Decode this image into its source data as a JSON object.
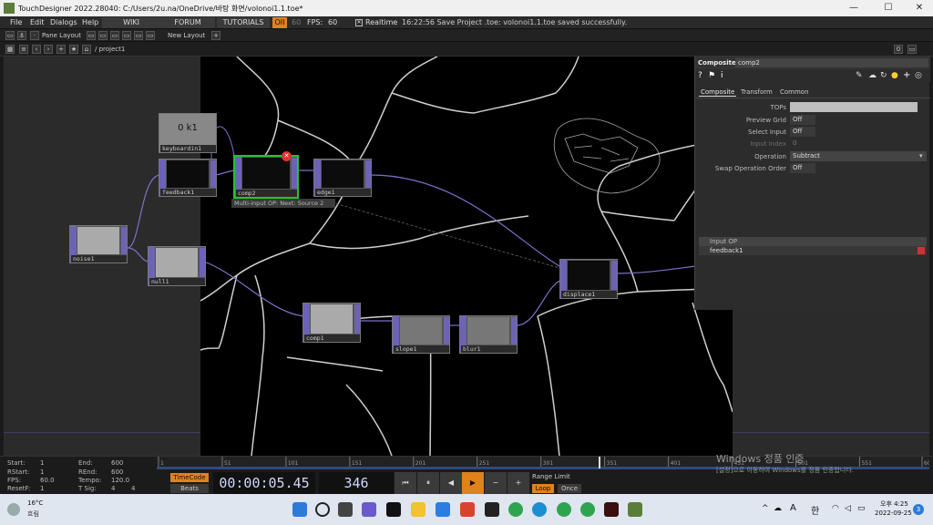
{
  "window": {
    "title": "TouchDesigner 2022.28040: C:/Users/2u.na/OneDrive/바탕 화면/volonoi1.1.toe*"
  },
  "menu": {
    "file": "File",
    "edit": "Edit",
    "dialogs": "Dialogs",
    "help": "Help",
    "wiki": "WIKI",
    "forum": "FORUM",
    "tutorials": "TUTORIALS",
    "oii": "OII",
    "fps_label": "FPS:",
    "fps_value": "60",
    "fps_dim": "60",
    "realtime": "Realtime",
    "status": "16:22:56 Save Project .toe: volonoi1.1.toe saved successfully."
  },
  "panebar": {
    "pane_layout": "Pane Layout",
    "new_layout": "New Layout"
  },
  "path": {
    "current": "/ project1"
  },
  "nodes": {
    "keyboardin": {
      "label": "keyboardin1",
      "value": "0 k1"
    },
    "feedback": {
      "label": "feedback1"
    },
    "comp2": {
      "label": "comp2"
    },
    "edge": {
      "label": "edge1"
    },
    "noise": {
      "label": "noise1"
    },
    "null": {
      "label": "null1"
    },
    "comp1": {
      "label": "comp1"
    },
    "slope": {
      "label": "slope1"
    },
    "blur": {
      "label": "blur1"
    },
    "displace": {
      "label": "displace1"
    },
    "tooltip": "Multi-input OP: Next: Source 2"
  },
  "panel": {
    "header_type": "Composite",
    "header_name": "comp2",
    "tabs": [
      "Composite",
      "Transform",
      "Common"
    ],
    "params": [
      {
        "label": "TOPs",
        "value": ""
      },
      {
        "label": "Preview Grid",
        "value": "Off"
      },
      {
        "label": "Select Input",
        "value": "Off"
      },
      {
        "label": "Input Index",
        "value": "0"
      },
      {
        "label": "Operation",
        "value": "Subtract"
      },
      {
        "label": "Swap Operation Order",
        "value": "Off"
      }
    ],
    "input_header": "Input OP",
    "input_item": "feedback1"
  },
  "timeline": {
    "start_label": "Start:",
    "start": "1",
    "end_label": "End:",
    "end": "600",
    "rstart_label": "RStart:",
    "rstart": "1",
    "rend_label": "REnd:",
    "rend": "600",
    "fps_label": "FPS:",
    "fps": "60.0",
    "tempo_label": "Tempo:",
    "tempo": "120.0",
    "resetf_label": "ResetF:",
    "resetf": "1",
    "tsig_label": "T Sig:",
    "tsig_a": "4",
    "tsig_b": "4",
    "timecode": "TimeCode",
    "beats": "Beats",
    "time": "00:00:05.45",
    "frame": "346",
    "range_limit": "Range Limit",
    "loop": "Loop",
    "once": "Once",
    "ruler_labels": [
      "1",
      "51",
      "101",
      "151",
      "201",
      "251",
      "301",
      "351",
      "401",
      "451",
      "501",
      "551",
      "600"
    ],
    "watermark_title": "Windows 정품 인증",
    "watermark_sub": "[설정]으로 이동하여 Windows를 정품 인증합니다."
  },
  "taskbar": {
    "temp": "16°C",
    "weather": "흐림",
    "time": "오후 4:25",
    "date": "2022-09-25",
    "ime_a": "A",
    "ime_han": "한",
    "notif": "3"
  },
  "colors": {
    "accent_green": "#27c136",
    "node_purple": "#6c63b5",
    "timecode_orange": "#e0821c"
  }
}
